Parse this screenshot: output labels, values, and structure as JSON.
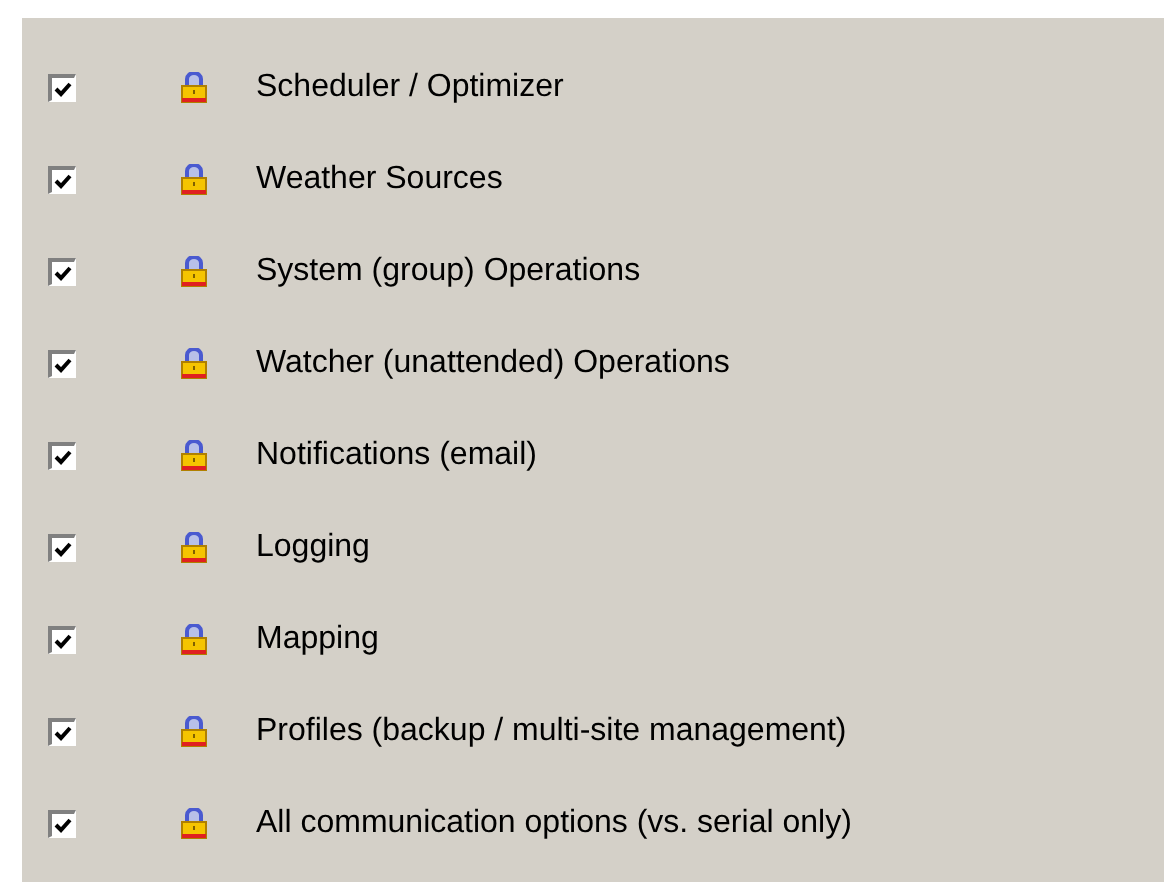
{
  "options": [
    {
      "label": "Scheduler / Optimizer",
      "checked": true
    },
    {
      "label": "Weather Sources",
      "checked": true
    },
    {
      "label": "System (group) Operations",
      "checked": true
    },
    {
      "label": "Watcher (unattended) Operations",
      "checked": true
    },
    {
      "label": "Notifications (email)",
      "checked": true
    },
    {
      "label": "Logging",
      "checked": true
    },
    {
      "label": "Mapping",
      "checked": true
    },
    {
      "label": "Profiles (backup / multi-site management)",
      "checked": true
    },
    {
      "label": "All communication options (vs. serial only)",
      "checked": true
    }
  ]
}
